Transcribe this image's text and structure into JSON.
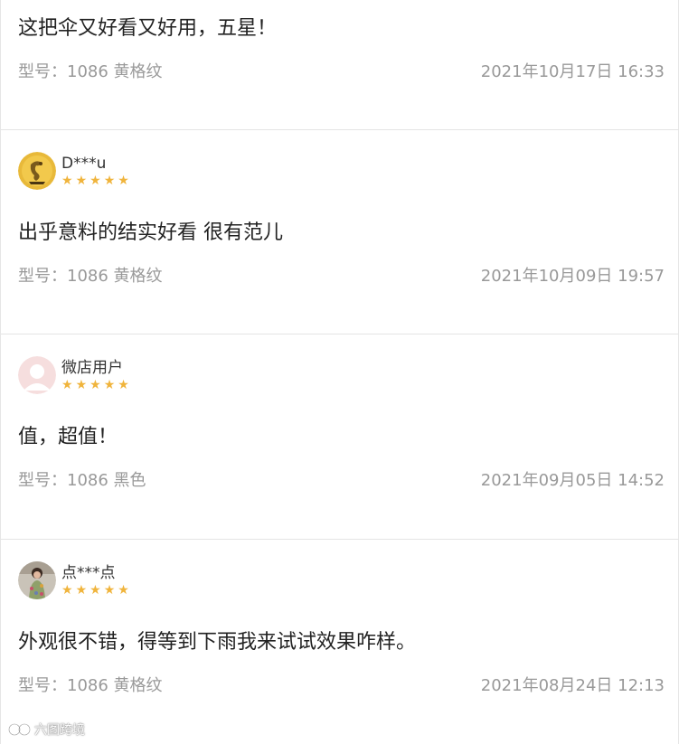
{
  "reviews": [
    {
      "content": "这把伞又好看又好用，五星！",
      "spec_label": "型号：",
      "spec_value": "1086 黄格纹",
      "datetime": "2021年10月17日 16:33"
    },
    {
      "username": "D***u",
      "content": "出乎意料的结实好看 很有范儿",
      "spec_label": "型号：",
      "spec_value": "1086 黄格纹",
      "datetime": "2021年10月09日 19:57",
      "rating": 5
    },
    {
      "username": "微店用户",
      "content": "值，超值！",
      "spec_label": "型号：",
      "spec_value": "1086 黑色",
      "datetime": "2021年09月05日 14:52",
      "rating": 5
    },
    {
      "username": "点***点",
      "content": "外观很不错，得等到下雨我来试试效果咋样。",
      "spec_label": "型号：",
      "spec_value": "1086 黄格纹",
      "datetime": "2021年08月24日 12:13",
      "rating": 5
    }
  ],
  "star_glyph": "★",
  "watermark": {
    "text": "六图跨境"
  },
  "colors": {
    "star": "#f0b43c",
    "meta_text": "#999999",
    "divider": "#e4e4e4"
  }
}
